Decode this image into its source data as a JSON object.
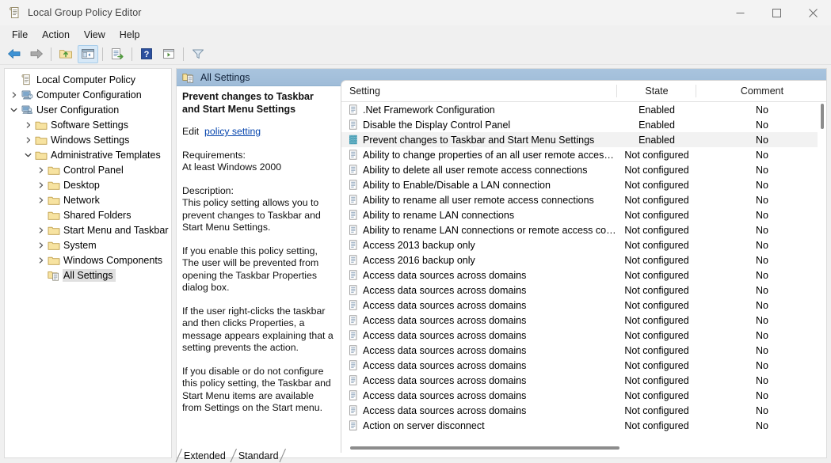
{
  "window": {
    "title": "Local Group Policy Editor",
    "icon": "policy-editor-icon",
    "minimize_label": "Minimize",
    "maximize_label": "Maximize",
    "close_label": "Close"
  },
  "menubar": {
    "items": [
      {
        "label": "File",
        "name": "menu-file"
      },
      {
        "label": "Action",
        "name": "menu-action"
      },
      {
        "label": "View",
        "name": "menu-view"
      },
      {
        "label": "Help",
        "name": "menu-help"
      }
    ]
  },
  "toolbar": {
    "buttons": [
      {
        "name": "back-button",
        "icon": "back-arrow-icon",
        "tooltip": "Back"
      },
      {
        "name": "forward-button",
        "icon": "forward-arrow-icon",
        "tooltip": "Forward"
      },
      {
        "name": "up-one-level-button",
        "icon": "folder-up-icon",
        "tooltip": "Up One Level"
      },
      {
        "name": "show-hide-console-tree-button",
        "icon": "console-tree-icon",
        "tooltip": "Show/Hide Console Tree"
      },
      {
        "name": "export-list-button",
        "icon": "export-list-icon",
        "tooltip": "Export List"
      },
      {
        "name": "help-button",
        "icon": "help-question-icon",
        "tooltip": "Help"
      },
      {
        "name": "properties-button",
        "icon": "properties-window-icon",
        "tooltip": "Properties"
      },
      {
        "name": "filter-button",
        "icon": "funnel-filter-icon",
        "tooltip": "Filter Options"
      }
    ]
  },
  "tree": {
    "root_label": "Local Computer Policy",
    "items": [
      {
        "label": "Local Computer Policy",
        "indent": 0,
        "chevron": "none",
        "icon": "policy-node-icon",
        "selected": false
      },
      {
        "label": "Computer Configuration",
        "indent": 1,
        "chevron": "collapsed",
        "icon": "computer-config-icon",
        "selected": false
      },
      {
        "label": "User Configuration",
        "indent": 1,
        "chevron": "expanded",
        "icon": "user-config-icon",
        "selected": false
      },
      {
        "label": "Software Settings",
        "indent": 2,
        "chevron": "collapsed",
        "icon": "folder-icon",
        "selected": false
      },
      {
        "label": "Windows Settings",
        "indent": 2,
        "chevron": "collapsed",
        "icon": "folder-icon",
        "selected": false
      },
      {
        "label": "Administrative Templates",
        "indent": 2,
        "chevron": "expanded",
        "icon": "folder-icon",
        "selected": false
      },
      {
        "label": "Control Panel",
        "indent": 3,
        "chevron": "collapsed",
        "icon": "folder-icon",
        "selected": false
      },
      {
        "label": "Desktop",
        "indent": 3,
        "chevron": "collapsed",
        "icon": "folder-icon",
        "selected": false
      },
      {
        "label": "Network",
        "indent": 3,
        "chevron": "collapsed",
        "icon": "folder-icon",
        "selected": false
      },
      {
        "label": "Shared Folders",
        "indent": 3,
        "chevron": "none",
        "icon": "folder-icon",
        "selected": false
      },
      {
        "label": "Start Menu and Taskbar",
        "indent": 3,
        "chevron": "collapsed",
        "icon": "folder-icon",
        "selected": false
      },
      {
        "label": "System",
        "indent": 3,
        "chevron": "collapsed",
        "icon": "folder-icon",
        "selected": false
      },
      {
        "label": "Windows Components",
        "indent": 3,
        "chevron": "collapsed",
        "icon": "folder-icon",
        "selected": false
      },
      {
        "label": "All Settings",
        "indent": 3,
        "chevron": "none",
        "icon": "all-settings-icon",
        "selected": true
      }
    ]
  },
  "pane": {
    "header_title": "All Settings",
    "header_icon": "all-settings-icon"
  },
  "description": {
    "title": "Prevent changes to Taskbar and Start Menu Settings",
    "edit_prefix": "Edit",
    "edit_link": "policy setting",
    "requirements_label": "Requirements:",
    "requirements_value": "At least Windows 2000",
    "description_label": "Description:",
    "paragraphs": [
      "This policy setting allows you to prevent changes to Taskbar and Start Menu Settings.",
      "If you enable this policy setting, The user will be prevented from opening the Taskbar Properties dialog box.",
      "If the user right-clicks the taskbar and then clicks Properties, a message appears explaining that a setting prevents the action.",
      "If you disable or do not configure this policy setting, the Taskbar and Start Menu items are available from Settings on the Start menu."
    ]
  },
  "list": {
    "columns": [
      {
        "label": "Setting",
        "name": "column-setting",
        "sorted": false
      },
      {
        "label": "State",
        "name": "column-state",
        "sorted": true,
        "sort_direction": "ascending"
      },
      {
        "label": "Comment",
        "name": "column-comment",
        "sorted": false
      }
    ],
    "rows": [
      {
        "setting": ".Net Framework Configuration",
        "state": "Enabled",
        "comment": "No",
        "icon": "policy-setting-icon",
        "selected": false
      },
      {
        "setting": "Disable the Display Control Panel",
        "state": "Enabled",
        "comment": "No",
        "icon": "policy-setting-icon",
        "selected": false
      },
      {
        "setting": "Prevent changes to Taskbar and Start Menu Settings",
        "state": "Enabled",
        "comment": "No",
        "icon": "policy-setting-selected-icon",
        "selected": true
      },
      {
        "setting": "Ability to change properties of an all user remote access con...",
        "state": "Not configured",
        "comment": "No",
        "icon": "policy-setting-icon",
        "selected": false
      },
      {
        "setting": "Ability to delete all user remote access connections",
        "state": "Not configured",
        "comment": "No",
        "icon": "policy-setting-icon",
        "selected": false
      },
      {
        "setting": "Ability to Enable/Disable a LAN connection",
        "state": "Not configured",
        "comment": "No",
        "icon": "policy-setting-icon",
        "selected": false
      },
      {
        "setting": "Ability to rename all user remote access connections",
        "state": "Not configured",
        "comment": "No",
        "icon": "policy-setting-icon",
        "selected": false
      },
      {
        "setting": "Ability to rename LAN connections",
        "state": "Not configured",
        "comment": "No",
        "icon": "policy-setting-icon",
        "selected": false
      },
      {
        "setting": "Ability to rename LAN connections or remote access conne...",
        "state": "Not configured",
        "comment": "No",
        "icon": "policy-setting-icon",
        "selected": false
      },
      {
        "setting": "Access 2013 backup only",
        "state": "Not configured",
        "comment": "No",
        "icon": "policy-setting-icon",
        "selected": false
      },
      {
        "setting": "Access 2016 backup only",
        "state": "Not configured",
        "comment": "No",
        "icon": "policy-setting-icon",
        "selected": false
      },
      {
        "setting": "Access data sources across domains",
        "state": "Not configured",
        "comment": "No",
        "icon": "policy-setting-icon",
        "selected": false
      },
      {
        "setting": "Access data sources across domains",
        "state": "Not configured",
        "comment": "No",
        "icon": "policy-setting-icon",
        "selected": false
      },
      {
        "setting": "Access data sources across domains",
        "state": "Not configured",
        "comment": "No",
        "icon": "policy-setting-icon",
        "selected": false
      },
      {
        "setting": "Access data sources across domains",
        "state": "Not configured",
        "comment": "No",
        "icon": "policy-setting-icon",
        "selected": false
      },
      {
        "setting": "Access data sources across domains",
        "state": "Not configured",
        "comment": "No",
        "icon": "policy-setting-icon",
        "selected": false
      },
      {
        "setting": "Access data sources across domains",
        "state": "Not configured",
        "comment": "No",
        "icon": "policy-setting-icon",
        "selected": false
      },
      {
        "setting": "Access data sources across domains",
        "state": "Not configured",
        "comment": "No",
        "icon": "policy-setting-icon",
        "selected": false
      },
      {
        "setting": "Access data sources across domains",
        "state": "Not configured",
        "comment": "No",
        "icon": "policy-setting-icon",
        "selected": false
      },
      {
        "setting": "Access data sources across domains",
        "state": "Not configured",
        "comment": "No",
        "icon": "policy-setting-icon",
        "selected": false
      },
      {
        "setting": "Access data sources across domains",
        "state": "Not configured",
        "comment": "No",
        "icon": "policy-setting-icon",
        "selected": false
      },
      {
        "setting": "Action on server disconnect",
        "state": "Not configured",
        "comment": "No",
        "icon": "policy-setting-icon",
        "selected": false
      }
    ]
  },
  "tabs": [
    {
      "label": "Extended",
      "name": "tab-extended",
      "active": false
    },
    {
      "label": "Standard",
      "name": "tab-standard",
      "active": true
    }
  ],
  "colors": {
    "pane_header": "#a9c4de",
    "selection": "#f2f2f2",
    "link": "#0645ad",
    "window_bg": "#f0f0f0"
  }
}
